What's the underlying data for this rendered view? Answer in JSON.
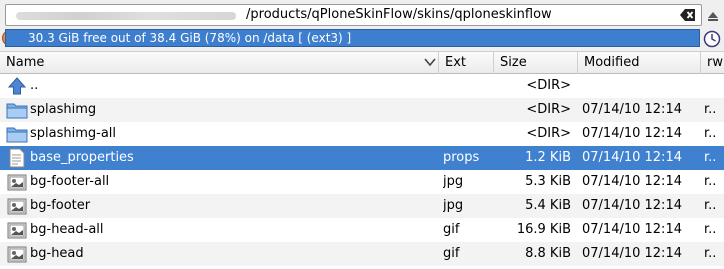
{
  "path": {
    "value": "/products/qPloneSkinFlow/skins/qploneskinflow"
  },
  "status": {
    "text": "30.3 GiB free out of 38.4 GiB (78%) on /data [ (ext3) ]"
  },
  "columns": {
    "name": "Name",
    "ext": "Ext",
    "size": "Size",
    "modified": "Modified",
    "rw": "rw"
  },
  "rows": [
    {
      "name": "..",
      "ext": "",
      "size": "<DIR>",
      "modified": "",
      "rw": "",
      "icon": "up-arrow-icon"
    },
    {
      "name": "splashimg",
      "ext": "",
      "size": "<DIR>",
      "modified": "07/14/10 12:14",
      "rw": "r..",
      "icon": "folder-icon"
    },
    {
      "name": "splashimg-all",
      "ext": "",
      "size": "<DIR>",
      "modified": "07/14/10 12:14",
      "rw": "r..",
      "icon": "folder-icon"
    },
    {
      "name": "base_properties",
      "ext": "props",
      "size": "1.2 KiB",
      "modified": "07/14/10 12:14",
      "rw": "r..",
      "icon": "text-file-icon"
    },
    {
      "name": "bg-footer-all",
      "ext": "jpg",
      "size": "5.3 KiB",
      "modified": "07/14/10 12:14",
      "rw": "r..",
      "icon": "image-file-icon"
    },
    {
      "name": "bg-footer",
      "ext": "jpg",
      "size": "5.4 KiB",
      "modified": "07/14/10 12:14",
      "rw": "r..",
      "icon": "image-file-icon"
    },
    {
      "name": "bg-head-all",
      "ext": "gif",
      "size": "16.9 KiB",
      "modified": "07/14/10 12:14",
      "rw": "r..",
      "icon": "image-file-icon"
    },
    {
      "name": "bg-head",
      "ext": "gif",
      "size": "8.8 KiB",
      "modified": "07/14/10 12:14",
      "rw": "r..",
      "icon": "image-file-icon"
    }
  ]
}
